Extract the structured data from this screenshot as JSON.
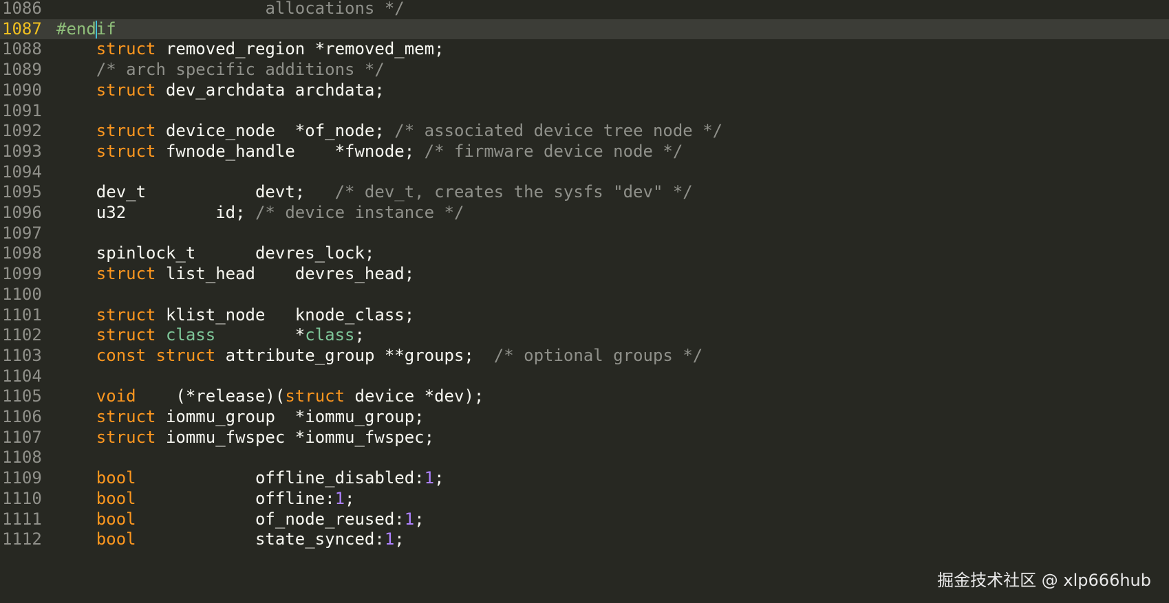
{
  "editor": {
    "current_line": "1087",
    "lines": [
      {
        "n": "1086",
        "t": [
          [
            "id",
            "                     "
          ],
          [
            "cmt",
            "allocations */"
          ]
        ]
      },
      {
        "n": "1087",
        "t": [
          [
            "pre",
            "#end"
          ],
          [
            "cursor",
            ""
          ],
          [
            "pre",
            "if"
          ]
        ]
      },
      {
        "n": "1088",
        "t": [
          [
            "id",
            "    "
          ],
          [
            "kw",
            "struct"
          ],
          [
            "id",
            " removed_region *removed_mem;"
          ]
        ]
      },
      {
        "n": "1089",
        "t": [
          [
            "id",
            "    "
          ],
          [
            "cmt",
            "/* arch specific additions */"
          ]
        ]
      },
      {
        "n": "1090",
        "t": [
          [
            "id",
            "    "
          ],
          [
            "kw",
            "struct"
          ],
          [
            "id",
            " dev_archdata archdata;"
          ]
        ]
      },
      {
        "n": "1091",
        "t": []
      },
      {
        "n": "1092",
        "t": [
          [
            "id",
            "    "
          ],
          [
            "kw",
            "struct"
          ],
          [
            "id",
            " device_node  *of_node; "
          ],
          [
            "cmt",
            "/* associated device tree node */"
          ]
        ]
      },
      {
        "n": "1093",
        "t": [
          [
            "id",
            "    "
          ],
          [
            "kw",
            "struct"
          ],
          [
            "id",
            " fwnode_handle    *fwnode; "
          ],
          [
            "cmt",
            "/* firmware device node */"
          ]
        ]
      },
      {
        "n": "1094",
        "t": []
      },
      {
        "n": "1095",
        "t": [
          [
            "id",
            "    dev_t           devt;   "
          ],
          [
            "cmt",
            "/* dev_t, creates the sysfs \"dev\" */"
          ]
        ]
      },
      {
        "n": "1096",
        "t": [
          [
            "id",
            "    u32         id; "
          ],
          [
            "cmt",
            "/* device instance */"
          ]
        ]
      },
      {
        "n": "1097",
        "t": []
      },
      {
        "n": "1098",
        "t": [
          [
            "id",
            "    spinlock_t      devres_lock;"
          ]
        ]
      },
      {
        "n": "1099",
        "t": [
          [
            "id",
            "    "
          ],
          [
            "kw",
            "struct"
          ],
          [
            "id",
            " list_head    devres_head;"
          ]
        ]
      },
      {
        "n": "1100",
        "t": []
      },
      {
        "n": "1101",
        "t": [
          [
            "id",
            "    "
          ],
          [
            "kw",
            "struct"
          ],
          [
            "id",
            " klist_node   knode_class;"
          ]
        ]
      },
      {
        "n": "1102",
        "t": [
          [
            "id",
            "    "
          ],
          [
            "kw",
            "struct"
          ],
          [
            "id",
            " "
          ],
          [
            "type",
            "class"
          ],
          [
            "id",
            "        *"
          ],
          [
            "type",
            "class"
          ],
          [
            "id",
            ";"
          ]
        ]
      },
      {
        "n": "1103",
        "t": [
          [
            "id",
            "    "
          ],
          [
            "kw",
            "const"
          ],
          [
            "id",
            " "
          ],
          [
            "kw",
            "struct"
          ],
          [
            "id",
            " attribute_group **groups;  "
          ],
          [
            "cmt",
            "/* optional groups */"
          ]
        ]
      },
      {
        "n": "1104",
        "t": []
      },
      {
        "n": "1105",
        "t": [
          [
            "id",
            "    "
          ],
          [
            "kw",
            "void"
          ],
          [
            "id",
            "    (*release)("
          ],
          [
            "kw",
            "struct"
          ],
          [
            "id",
            " device *dev);"
          ]
        ]
      },
      {
        "n": "1106",
        "t": [
          [
            "id",
            "    "
          ],
          [
            "kw",
            "struct"
          ],
          [
            "id",
            " iommu_group  *iommu_group;"
          ]
        ]
      },
      {
        "n": "1107",
        "t": [
          [
            "id",
            "    "
          ],
          [
            "kw",
            "struct"
          ],
          [
            "id",
            " iommu_fwspec *iommu_fwspec;"
          ]
        ]
      },
      {
        "n": "1108",
        "t": []
      },
      {
        "n": "1109",
        "t": [
          [
            "id",
            "    "
          ],
          [
            "kw",
            "bool"
          ],
          [
            "id",
            "            offline_disabled:"
          ],
          [
            "num",
            "1"
          ],
          [
            "id",
            ";"
          ]
        ]
      },
      {
        "n": "1110",
        "t": [
          [
            "id",
            "    "
          ],
          [
            "kw",
            "bool"
          ],
          [
            "id",
            "            offline:"
          ],
          [
            "num",
            "1"
          ],
          [
            "id",
            ";"
          ]
        ]
      },
      {
        "n": "1111",
        "t": [
          [
            "id",
            "    "
          ],
          [
            "kw",
            "bool"
          ],
          [
            "id",
            "            of_node_reused:"
          ],
          [
            "num",
            "1"
          ],
          [
            "id",
            ";"
          ]
        ]
      },
      {
        "n": "1112",
        "t": [
          [
            "id",
            "    "
          ],
          [
            "kw",
            "bool"
          ],
          [
            "id",
            "            state_synced:"
          ],
          [
            "num",
            "1"
          ],
          [
            "id",
            ";"
          ]
        ]
      }
    ]
  },
  "watermark": "掘金技术社区 @ xlp666hub",
  "colors": {
    "background": "#272822",
    "current_line_bg": "#3c3d37",
    "keyword": "#fd971f",
    "type": "#7ec699",
    "number": "#ae81ff",
    "comment": "#8f908a",
    "line_number": "#90908a",
    "current_line_number": "#f0c020"
  }
}
